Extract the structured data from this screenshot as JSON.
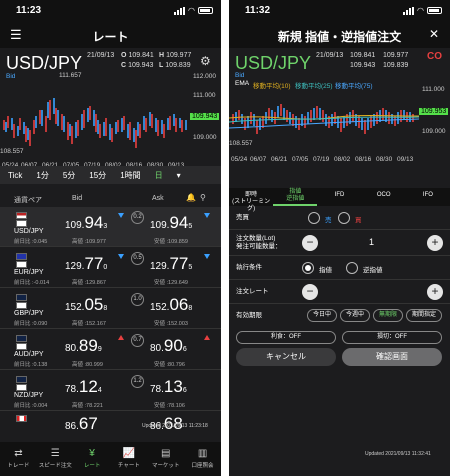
{
  "left": {
    "time": "11:23",
    "title": "レート",
    "pair": "USD/JPY",
    "date": "21/09/13",
    "ohlc": {
      "o_label": "O",
      "o": "109.841",
      "h_label": "H",
      "h": "109.977",
      "c_label": "C",
      "c": "109.943",
      "l_label": "L",
      "l": "109.839"
    },
    "series_label": "Bid",
    "chart_high": "111.657",
    "chart_low": "108.557",
    "yticks": [
      "112.000",
      "111.000",
      "110.000",
      "109.000"
    ],
    "last_price": "109.943",
    "xticks": [
      "05/24",
      "06/07",
      "06/21",
      "07/05",
      "07/19",
      "08/02",
      "08/16",
      "08/30",
      "09/13"
    ],
    "timeframes": [
      "Tick",
      "1分",
      "5分",
      "15分",
      "1時間",
      "日"
    ],
    "tf_more": "▾",
    "cols": {
      "pair": "通貨ペア",
      "bid": "Bid",
      "ask": "Ask"
    },
    "rows": [
      {
        "pair": "USD/JPY",
        "prev": "前日比 :0.045",
        "bid_pre": "109.",
        "bid_big": "94",
        "bid_small": "3",
        "ask_pre": "109.",
        "ask_big": "94",
        "ask_small": "5",
        "spread": "0.2",
        "high": "高値 :109.977",
        "low": "安値 :109.859",
        "dir": "down"
      },
      {
        "pair": "EUR/JPY",
        "prev": "前日比 :-0.014",
        "bid_pre": "129.",
        "bid_big": "77",
        "bid_small": "0",
        "ask_pre": "129.",
        "ask_big": "77",
        "ask_small": "5",
        "spread": "0.5",
        "high": "高値 :129.867",
        "low": "安値 :129.649",
        "dir": "down"
      },
      {
        "pair": "GBP/JPY",
        "prev": "前日比 :0.090",
        "bid_pre": "152.",
        "bid_big": "05",
        "bid_small": "8",
        "ask_pre": "152.",
        "ask_big": "06",
        "ask_small": "8",
        "spread": "1.0",
        "high": "高値 :152.167",
        "low": "安値 :152.003",
        "dir": "none"
      },
      {
        "pair": "AUD/JPY",
        "prev": "前日比 :0.138",
        "bid_pre": "80.",
        "bid_big": "89",
        "bid_small": "9",
        "ask_pre": "80.",
        "ask_big": "90",
        "ask_small": "6",
        "spread": "0.7",
        "high": "高値 :80.999",
        "low": "安値 :80.796",
        "dir": "up"
      },
      {
        "pair": "NZD/JPY",
        "prev": "前日比 :0.004",
        "bid_pre": "78.",
        "bid_big": "12",
        "bid_small": "4",
        "ask_pre": "78.",
        "ask_big": "13",
        "ask_small": "6",
        "spread": "1.2",
        "high": "高値 :78.221",
        "low": "安値 :78.106",
        "dir": "none"
      },
      {
        "pair": "CAD/JPY",
        "prev": "",
        "bid_pre": "86.",
        "bid_big": "67",
        "bid_small": "",
        "ask_pre": "86.",
        "ask_big": "68",
        "ask_small": "",
        "spread": "",
        "high": "",
        "low": "",
        "dir": "none"
      }
    ],
    "updated": "Updated 2021/09/13 11:23:18",
    "tabs": [
      "トレード",
      "スピード注文",
      "レート",
      "チャート",
      "マーケット",
      "口座照会"
    ]
  },
  "right": {
    "time": "11:32",
    "title": "新規 指値・逆指値注文",
    "pair": "USD/JPY",
    "date": "21/09/13",
    "ohlc": {
      "o": "109.841",
      "h": "109.977",
      "c": "109.943",
      "l": "109.839"
    },
    "series_label": "Bid",
    "ema_label": "EMA",
    "ma1": "移動平均(10)",
    "ma2": "移動平均(25)",
    "ma3": "移動平均(75)",
    "yticks": [
      "111.000",
      "110.000",
      "109.000"
    ],
    "last_price": "109.953",
    "chart_low": "108.557",
    "xticks": [
      "05/24",
      "06/07",
      "06/21",
      "07/05",
      "07/19",
      "08/02",
      "08/16",
      "08/30",
      "09/13"
    ],
    "order_tabs": [
      "即時\n(ストリーミング)",
      "指値\n逆指値",
      "IFD",
      "OCO",
      "IFO"
    ],
    "sell_buy_label": "売買",
    "buy": "売",
    "sell": "買",
    "qty_label": "注文数量(Lot)\n発注可能数量：",
    "qty": "1",
    "exec_label": "執行条件",
    "limit": "指値",
    "stop": "逆指値",
    "rate_label": "注文レート",
    "expiry_label": "有効期限",
    "expiry_opts": [
      "今日中",
      "今週中",
      "無期限",
      "期間指定"
    ],
    "profit": "利食：OFF",
    "loss": "損切：OFF",
    "cancel": "キャンセル",
    "confirm": "確認画面",
    "updated": "Updated 2021/09/13 11:32:41",
    "accent": "#6fd36b"
  }
}
